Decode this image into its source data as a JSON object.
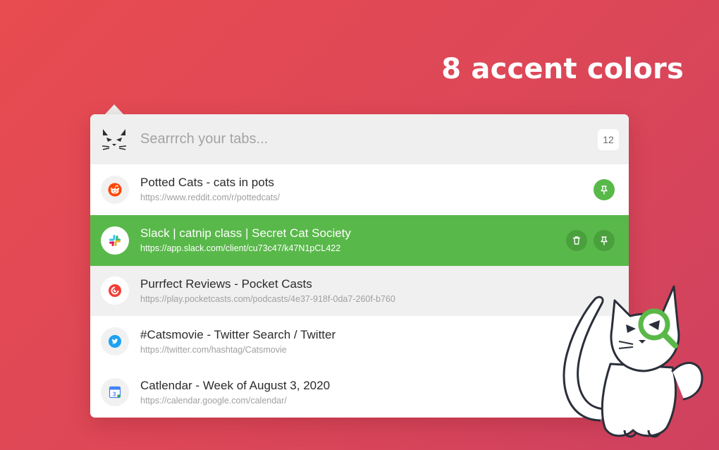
{
  "headline": "8 accent colors",
  "search": {
    "placeholder": "Searrrch your tabs...",
    "tab_count": "12"
  },
  "tabs": [
    {
      "title": "Potted Cats - cats in pots",
      "url": "https://www.reddit.com/r/pottedcats/",
      "favicon": "reddit-icon",
      "state": "pinned"
    },
    {
      "title": "Slack | catnip class | Secret Cat Society",
      "url": "https://app.slack.com/client/cu73c47/k47N1pCL422",
      "favicon": "slack-icon",
      "state": "selected"
    },
    {
      "title": "Purrfect Reviews - Pocket Casts",
      "url": "https://play.pocketcasts.com/podcasts/4e37-918f-0da7-260f-b760",
      "favicon": "pocketcasts-icon",
      "state": "hovered"
    },
    {
      "title": "#Catsmovie - Twitter Search / Twitter",
      "url": "https://twitter.com/hashtag/Catsmovie",
      "favicon": "twitter-icon",
      "state": "normal"
    },
    {
      "title": "Catlendar - Week of August 3, 2020",
      "url": "https://calendar.google.com/calendar/",
      "favicon": "google-calendar-icon",
      "state": "normal"
    }
  ],
  "colors": {
    "accent": "#59b84a",
    "background_start": "#e84b50",
    "background_end": "#cf415f"
  }
}
